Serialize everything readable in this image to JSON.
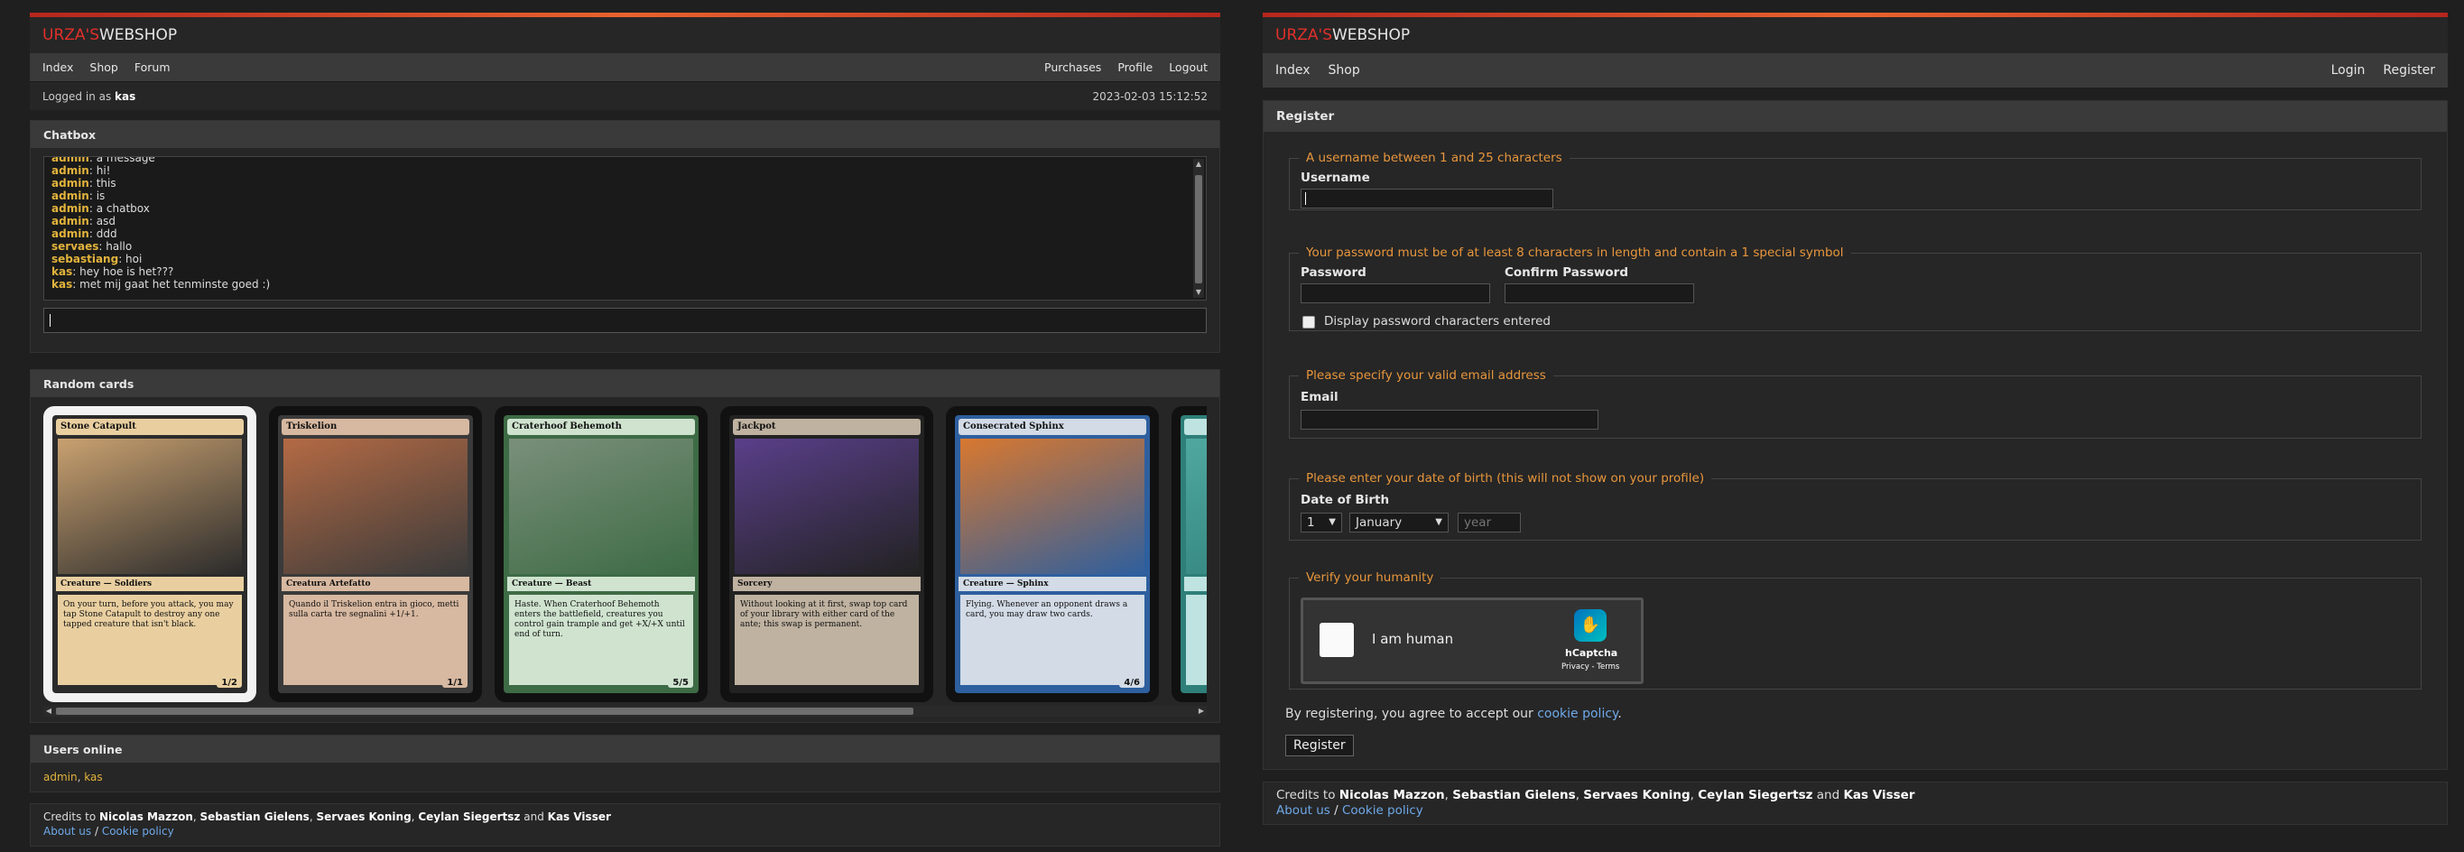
{
  "left": {
    "brand": {
      "accent": "URZA'S",
      "rest": " WEBSHOP"
    },
    "nav": {
      "index": "Index",
      "shop": "Shop",
      "forum": "Forum",
      "purchases": "Purchases",
      "profile": "Profile",
      "logout": "Logout"
    },
    "userbar": {
      "prefix": "Logged in as ",
      "username": "kas",
      "datetime": "2023-02-03 15:12:52"
    },
    "chatbox": {
      "title": "Chatbox",
      "messages": [
        {
          "user": "admin",
          "text": ": a message"
        },
        {
          "user": "admin",
          "text": ": hi!"
        },
        {
          "user": "admin",
          "text": ": this"
        },
        {
          "user": "admin",
          "text": ": is"
        },
        {
          "user": "admin",
          "text": ": a chatbox"
        },
        {
          "user": "admin",
          "text": ": asd"
        },
        {
          "user": "admin",
          "text": ": ddd"
        },
        {
          "user": "servaes",
          "text": ": hallo"
        },
        {
          "user": "sebastiang",
          "text": ": hoi"
        },
        {
          "user": "kas",
          "text": ": hey hoe is het???"
        },
        {
          "user": "kas",
          "text": ": met mij gaat het tenminste goed :)"
        }
      ]
    },
    "cards": {
      "title": "Random cards",
      "items": [
        {
          "name": "Stone Catapult",
          "type": "Creature — Soldiers",
          "text": "On your turn, before you attack, you may tap Stone Catapult to destroy any one tapped creature that isn't black.",
          "pt": "1/2",
          "colors": [
            "#f2f2f2",
            "#c9a170",
            "#e9cfa0",
            "#2b2b2b"
          ]
        },
        {
          "name": "Triskelion",
          "type": "Creatura Artefatto",
          "text": "Quando il Triskelion entra in gioco, metti sulla carta tre segnalini +1/+1.",
          "pt": "1/1",
          "colors": [
            "#111111",
            "#b46a44",
            "#d7b8a0",
            "#3a3a3a"
          ]
        },
        {
          "name": "Craterhoof Behemoth",
          "type": "Creature — Beast",
          "text": "Haste. When Craterhoof Behemoth enters the battlefield, creatures you control gain trample and get +X/+X until end of turn.",
          "pt": "5/5",
          "colors": [
            "#111111",
            "#7a8f7a",
            "#cfe3cf",
            "#3d6b45"
          ]
        },
        {
          "name": "Jackpot",
          "type": "Sorcery",
          "text": "Without looking at it first, swap top card of your library with either card of the ante; this swap is permanent.",
          "pt": "",
          "colors": [
            "#111111",
            "#5a3f8a",
            "#bfb2a0",
            "#222222"
          ]
        },
        {
          "name": "Consecrated Sphinx",
          "type": "Creature — Sphinx",
          "text": "Flying. Whenever an opponent draws a card, you may draw two cards.",
          "pt": "4/6",
          "colors": [
            "#111111",
            "#d9782f",
            "#d2dbe6",
            "#2e5f9e"
          ]
        },
        {
          "name": "",
          "type": "",
          "text": "",
          "pt": "",
          "colors": [
            "#111111",
            "#4fa8a0",
            "#bfe3e0",
            "#2e7f79"
          ]
        }
      ]
    },
    "online": {
      "title": "Users online",
      "users": [
        "admin",
        "kas"
      ],
      "separator": ", "
    },
    "credits": {
      "prefix": "Credits to ",
      "names": [
        "Nicolas Mazzon",
        "Sebastian Gielens",
        "Servaes Koning",
        "Ceylan Siegertsz"
      ],
      "and": " and ",
      "last": "Kas Visser",
      "about": "About us",
      "slash": " / ",
      "cookie": "Cookie policy"
    }
  },
  "right": {
    "brand": {
      "accent": "URZA'S",
      "rest": " WEBSHOP"
    },
    "nav": {
      "index": "Index",
      "shop": "Shop",
      "login": "Login",
      "register": "Register"
    },
    "panel_title": "Register",
    "username": {
      "legend": "A username between 1 and 25 characters",
      "label": "Username"
    },
    "password": {
      "legend": "Your password must be of at least 8 characters in length and contain a 1 special symbol",
      "label": "Password",
      "confirm_label": "Confirm Password",
      "show_label": "Display password characters entered"
    },
    "email": {
      "legend": "Please specify your valid email address",
      "label": "Email"
    },
    "dob": {
      "legend": "Please enter your date of birth (this will not show on your profile)",
      "label": "Date of Birth",
      "day": "1",
      "month": "January",
      "year_placeholder": "year"
    },
    "captcha": {
      "legend": "Verify your humanity",
      "label": "I am human",
      "brand": "hCaptcha",
      "privacy": "Privacy - Terms"
    },
    "agree": {
      "prefix": "By registering, you agree to accept our ",
      "link": "cookie policy",
      "suffix": "."
    },
    "register_button": "Register",
    "credits": {
      "prefix": "Credits to ",
      "names": [
        "Nicolas Mazzon",
        "Sebastian Gielens",
        "Servaes Koning",
        "Ceylan Siegertsz"
      ],
      "and": " and ",
      "last": "Kas Visser",
      "about": "About us",
      "slash": " / ",
      "cookie": "Cookie policy"
    }
  }
}
